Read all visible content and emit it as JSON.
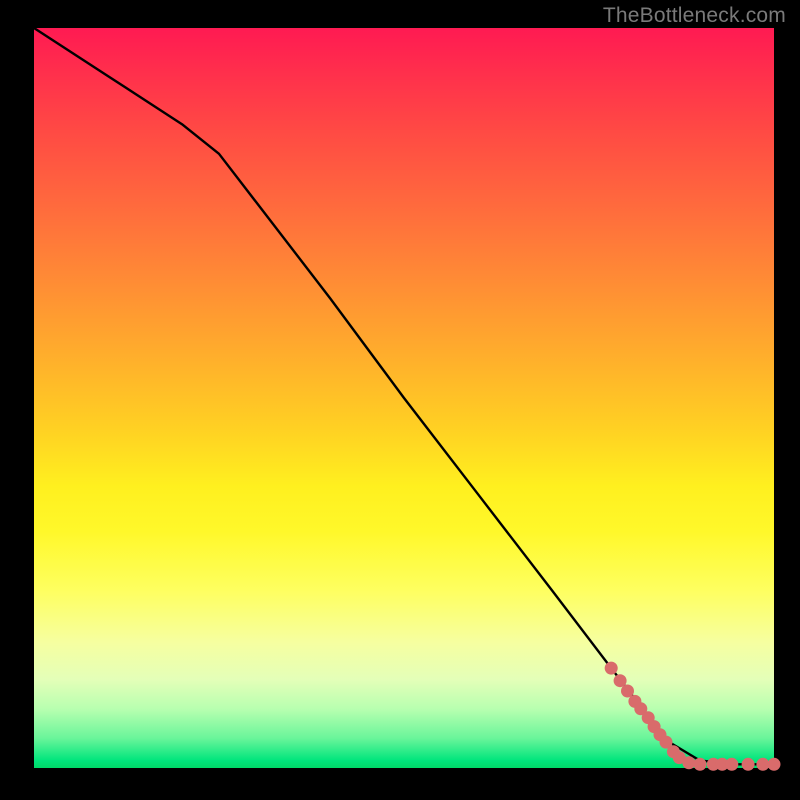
{
  "watermark": "TheBottleneck.com",
  "colors": {
    "frame_bg": "#000000",
    "line": "#000000",
    "marker_fill": "#d96b6b",
    "marker_stroke": "#b84e4e",
    "gradient_top": "#ff1a52",
    "gradient_mid": "#fff01f",
    "gradient_bottom": "#00d968"
  },
  "chart_data": {
    "type": "line",
    "title": "",
    "xlabel": "",
    "ylabel": "",
    "xlim": [
      0,
      100
    ],
    "ylim": [
      0,
      100
    ],
    "grid": false,
    "legend": false,
    "series": [
      {
        "name": "curve",
        "x": [
          0,
          10,
          20,
          25,
          30,
          40,
          50,
          60,
          70,
          78,
          83,
          85,
          90,
          95,
          100
        ],
        "y": [
          100,
          93.5,
          87,
          83,
          76.5,
          63.5,
          50,
          37,
          24,
          13.5,
          7,
          4,
          1,
          0.5,
          0.5
        ]
      }
    ],
    "markers": {
      "name": "hotspots",
      "points": [
        {
          "x": 78.0,
          "y": 13.5
        },
        {
          "x": 79.2,
          "y": 11.8
        },
        {
          "x": 80.2,
          "y": 10.4
        },
        {
          "x": 81.2,
          "y": 9.0
        },
        {
          "x": 82.0,
          "y": 8.0
        },
        {
          "x": 83.0,
          "y": 6.8
        },
        {
          "x": 83.8,
          "y": 5.6
        },
        {
          "x": 84.6,
          "y": 4.5
        },
        {
          "x": 85.4,
          "y": 3.5
        },
        {
          "x": 86.4,
          "y": 2.2
        },
        {
          "x": 87.2,
          "y": 1.4
        },
        {
          "x": 88.5,
          "y": 0.7
        },
        {
          "x": 90.0,
          "y": 0.5
        },
        {
          "x": 91.8,
          "y": 0.5
        },
        {
          "x": 93.0,
          "y": 0.5
        },
        {
          "x": 94.3,
          "y": 0.5
        },
        {
          "x": 96.5,
          "y": 0.5
        },
        {
          "x": 98.5,
          "y": 0.5
        },
        {
          "x": 100.0,
          "y": 0.5
        }
      ]
    }
  }
}
